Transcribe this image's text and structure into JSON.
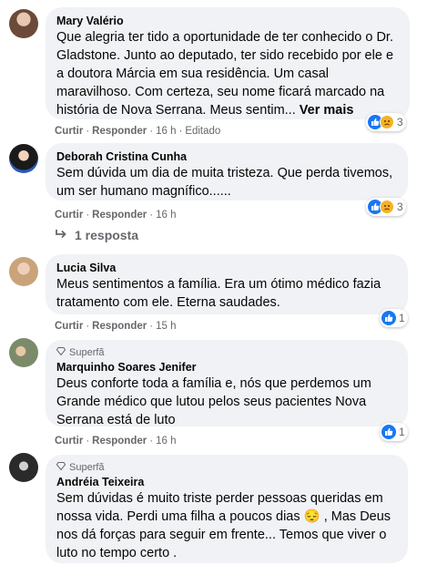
{
  "comments": [
    {
      "author": "Mary Valério",
      "text": "Que alegria ter tido a oportunidade de ter conhecido o Dr. Gladstone. Junto ao deputado, ter sido recebido por ele e a doutora Márcia em sua residência. Um casal maravilhoso. Com certeza, seu nome ficará marcado na história de Nova Serrana. Meus sentim...",
      "see_more": "Ver mais",
      "like_label": "Curtir",
      "reply_label": "Responder",
      "time": "16 h",
      "edited": "Editado",
      "reactions": [
        "like",
        "sad"
      ],
      "reaction_count": "3"
    },
    {
      "author": "Deborah Cristina Cunha",
      "text": "Sem dúvida um dia de muita tristeza. Que perda tivemos, um ser humano magnífico......",
      "like_label": "Curtir",
      "reply_label": "Responder",
      "time": "16 h",
      "reactions": [
        "like",
        "sad"
      ],
      "reaction_count": "3",
      "replies_link": "1 resposta"
    },
    {
      "author": "Lucia Silva",
      "text": "Meus sentimentos a família. Era um ótimo médico fazia tratamento com ele. Eterna saudades.",
      "like_label": "Curtir",
      "reply_label": "Responder",
      "time": "15 h",
      "reactions": [
        "like"
      ],
      "reaction_count": "1"
    },
    {
      "badge": "Superfã",
      "author": "Marquinho Soares Jenifer",
      "text": "Deus conforte toda a família e, nós que perdemos um Grande médico que lutou pelos seus pacientes Nova Serrana está de luto",
      "like_label": "Curtir",
      "reply_label": "Responder",
      "time": "16 h",
      "reactions": [
        "like"
      ],
      "reaction_count": "1"
    },
    {
      "badge": "Superfã",
      "author": "Andréia Teixeira",
      "text_part1": "Sem dúvidas é muito triste perder pessoas queridas em nossa vida. Perdi uma filha a poucos dias ",
      "emoji": "😔",
      "text_part2": " , Mas Deus nos dá forças para seguir em frente... Temos que viver o luto no tempo certo ."
    }
  ],
  "separator": "·",
  "colors": {
    "bubble": "#f0f2f5",
    "like": "#1877f2",
    "sad": "#f7b125",
    "meta": "#65676b"
  }
}
